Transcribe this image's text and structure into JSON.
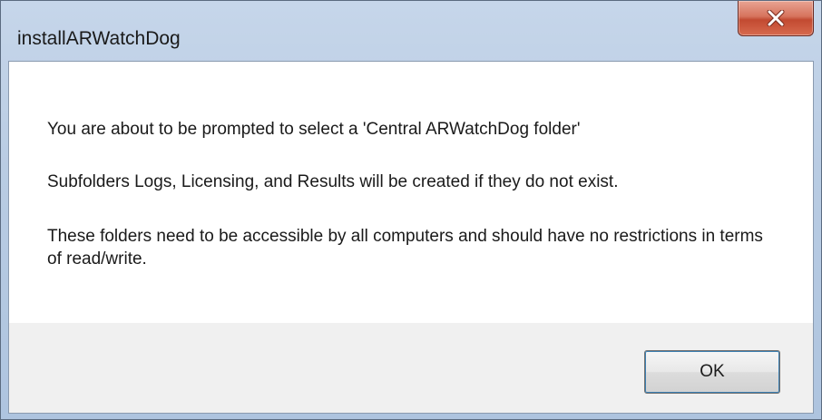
{
  "window": {
    "title": "installARWatchDog"
  },
  "message": {
    "line1": "You are about to be prompted to select a 'Central ARWatchDog folder'",
    "line2": "Subfolders Logs, Licensing, and Results will be created if they do not exist.",
    "line3": "These folders need to be accessible by all computers and should have no restrictions in terms of read/write."
  },
  "buttons": {
    "ok_label": "OK"
  },
  "icons": {
    "close": "close-icon"
  },
  "colors": {
    "close_button": "#c24a31",
    "ok_focus_border": "#3c7fb1",
    "content_background": "#ffffff",
    "footer_background": "#f0f0f0"
  }
}
